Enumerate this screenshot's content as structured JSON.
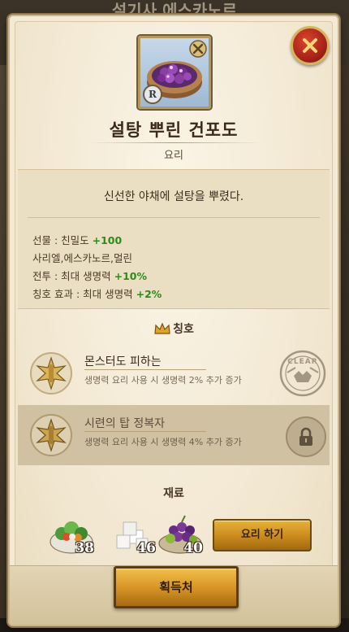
{
  "background": {
    "title": "설기사 에스카노르"
  },
  "close_button": {
    "icon": "close-icon"
  },
  "item": {
    "name": "설탕 뿌린 건포도",
    "type": "요리",
    "rank_badge": "R",
    "description": "신선한 야채에 설탕을 뿌렸다."
  },
  "stats": [
    {
      "label": "선물 : 친밀도 ",
      "value": "+100"
    },
    {
      "label": "사리엘,에스카노르,멀린",
      "value": ""
    },
    {
      "label": "전투 : 최대 생명력 ",
      "value": "+10%"
    },
    {
      "label": "칭호 효과 : 최대 생명력 ",
      "value": "+2%"
    }
  ],
  "titles_section": {
    "header": "칭호",
    "items": [
      {
        "name": "몬스터도 피하는",
        "desc": "생명력 요리 사용 시 생명력 2% 추가 증가",
        "status": "CLEAR",
        "locked": false
      },
      {
        "name": "시련의 탑 정복자",
        "desc": "생명력 요리 사용 시 생명력 4% 추가 증가",
        "status": "locked",
        "locked": true
      }
    ]
  },
  "materials": {
    "header": "재료",
    "items": [
      {
        "icon": "vegetable-bowl-icon",
        "count": "38"
      },
      {
        "icon": "sugar-cubes-icon",
        "count": "46"
      },
      {
        "icon": "grapes-icon",
        "count": "40"
      }
    ],
    "cook_label": "요리 하기"
  },
  "source_button": {
    "label": "획득처"
  }
}
